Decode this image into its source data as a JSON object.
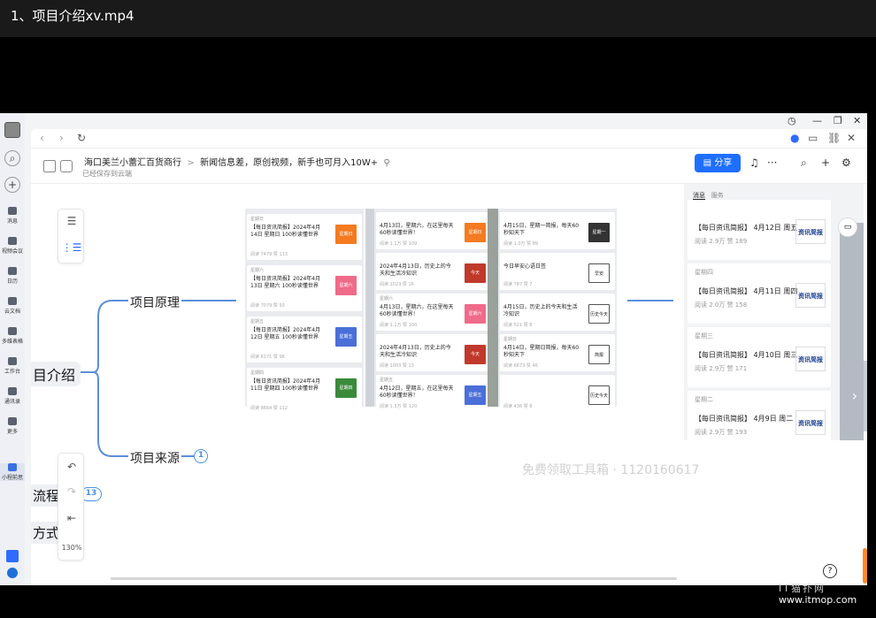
{
  "video_title": "1、项目介绍xv.mp4",
  "left_sidebar": {
    "items": [
      {
        "label": "消息",
        "icon": "chat-icon"
      },
      {
        "label": "视频会议",
        "icon": "video-icon"
      },
      {
        "label": "日历",
        "icon": "calendar-icon"
      },
      {
        "label": "云文档",
        "icon": "document-icon"
      },
      {
        "label": "多维表格",
        "icon": "table-icon"
      },
      {
        "label": "工作台",
        "icon": "grid-icon"
      },
      {
        "label": "通讯录",
        "icon": "contacts-icon"
      },
      {
        "label": "更多",
        "icon": "more-icon"
      },
      {
        "label": "小程前思",
        "icon": "app-icon"
      }
    ]
  },
  "doc": {
    "breadcrumb_root": "海口美兰小蕾汇百货商行",
    "breadcrumb_sep": ">",
    "title": "新闻信息差，原创视频，新手也可月入10W+",
    "saved_status": "已经保存到云端",
    "share_label": "分享",
    "more_label": "···"
  },
  "mindmap": {
    "root_label": "目介绍",
    "branch_principle": "项目原理",
    "branch_source": "项目来源",
    "branch_source_count": "1",
    "node_flow": "流程",
    "node_flow_count": "13",
    "node_method": "方式",
    "zoom": "130%"
  },
  "cards_left": [
    {
      "date": "星期日",
      "title": "【每日资讯简报】2024年4月14日 星期日 100秒读懂世界",
      "meta": "阅读 7479  赞 113",
      "thumb": "星期日",
      "color": "#f47b20"
    },
    {
      "date": "星期六",
      "title": "【每日资讯简报】2024年4月13日 星期六 100秒读懂世界",
      "meta": "阅读 7079  赞 93",
      "thumb": "星期六",
      "color": "#f06a8a"
    },
    {
      "date": "星期五",
      "title": "【每日资讯简报】2024年4月12日 星期五 100秒读懂世界",
      "meta": "阅读 6171  赞 96",
      "thumb": "星期五",
      "color": "#4a6fd8"
    },
    {
      "date": "星期四",
      "title": "【每日资讯简报】2024年4月11日 星期四 100秒读懂世界",
      "meta": "阅读 8664  赞 112",
      "thumb": "星期四",
      "color": "#3b8a3b"
    }
  ],
  "cards_mid": [
    {
      "date": "",
      "title": "4月13日，星期六，在这里每天60秒读懂世界！",
      "meta": "阅读 1.1万  赞 109",
      "thumb": "星期日",
      "color": "#f47b20"
    },
    {
      "date": "",
      "title": "2024年4月13日，历史上的今天和生活冷知识",
      "meta": "阅读 1023  赞 16",
      "thumb": "今天",
      "color": "#c0392b"
    },
    {
      "date": "星期六",
      "title": "4月13日，星期六，在这里每天60秒读懂世界！",
      "meta": "阅读 1.1万  赞 100",
      "thumb": "星期六",
      "color": "#f06a8a"
    },
    {
      "date": "",
      "title": "2024年4月13日，历史上的今天和生活冷知识",
      "meta": "阅读 1003  赞 13",
      "thumb": "今天",
      "color": "#c0392b"
    },
    {
      "date": "星期五",
      "title": "4月12日，星期五，在这里每天60秒读懂世界！",
      "meta": "阅读 1.3万  赞 120",
      "thumb": "星期五",
      "color": "#4a6fd8"
    }
  ],
  "cards_right": [
    {
      "date": "",
      "title": "4月15日，星期一简报，每天60秒知天下",
      "meta": "阅读 1.0万  赞 89",
      "thumb": "星期一",
      "color": "#333333"
    },
    {
      "date": "",
      "title": "今日早安心语日签",
      "meta": "阅读 787  赞 7",
      "thumb": "早安",
      "color": "#ffffff"
    },
    {
      "date": "",
      "title": "4月15日，历史上的今天和生活冷知识",
      "meta": "阅读 521  赞 8",
      "thumb": "历史今天",
      "color": "#ffffff"
    },
    {
      "date": "星期日",
      "title": "4月14日，星期日简报，每天60秒知天下",
      "meta": "阅读 6673  赞 46",
      "thumb": "简报",
      "color": "#ffffff"
    },
    {
      "date": "",
      "title": "",
      "meta": "阅读 436  赞 8",
      "thumb": "历史今天",
      "color": "#ffffff"
    }
  ],
  "right_panel": {
    "tabs": [
      "消息",
      "服务"
    ],
    "cards": [
      {
        "date": "",
        "title": "【每日资讯简报】 4月12日 周五",
        "meta": "阅读 2.9万  赞 189",
        "logo": "资讯简报"
      },
      {
        "date": "星期四",
        "title": "【每日资讯简报】 4月11日 周四",
        "meta": "阅读 2.0万  赞 158",
        "logo": "资讯简报"
      },
      {
        "date": "星期三",
        "title": "【每日资讯简报】 4月10日 周三",
        "meta": "阅读 2.9万  赞 171",
        "logo": "资讯简报"
      },
      {
        "date": "星期二",
        "title": "【每日资讯简报】 4月9日 周二",
        "meta": "阅读 2.9万  赞 193",
        "logo": "资讯简报"
      }
    ]
  },
  "watermark": "免费领取工具箱 · 1120160617",
  "site": "www.itmop.com",
  "site_logo": "IT猫扑网"
}
